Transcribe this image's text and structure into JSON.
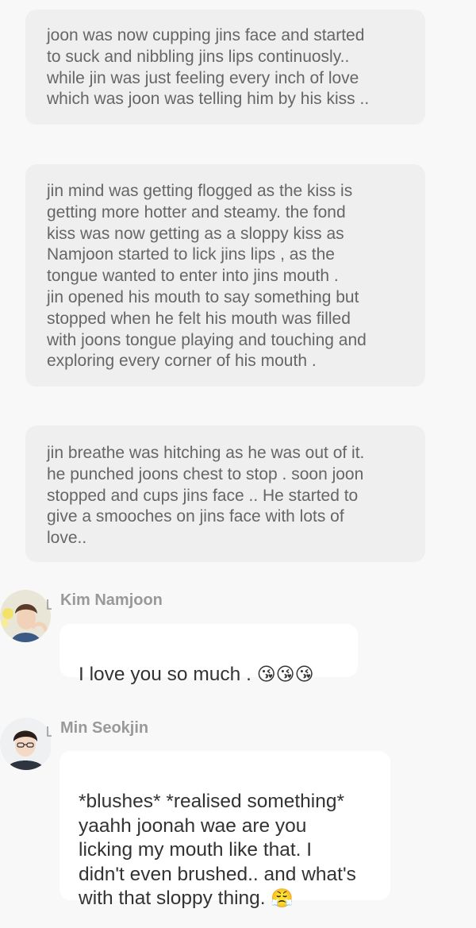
{
  "narrations": [
    {
      "text": "joon was now cupping jins face and started\nto suck and nibbling jins lips continuosly..\nwhile jin was just feeling every inch of love\nwhich was joon was telling him by his kiss .."
    },
    {
      "text": "jin mind was getting flogged as the kiss is\ngetting more hotter and steamy.  the fond\nkiss was now getting as a sloppy kiss as\nNamjoon started to lick jins lips , as the\ntongue wanted to enter into jins mouth .\njin opened his mouth to say something but\nstopped when he felt his mouth was filled\nwith joons tongue playing and touching and\nexploring every corner of his mouth ."
    },
    {
      "text": "jin breathe was hitching as he was out of it.\nhe punched joons chest to stop . soon joon\nstopped and cups jins face .. He started to\ngive a smooches on jins face with lots of\nlove.."
    }
  ],
  "messages": [
    {
      "sender": "Kim Namjoon",
      "text": "I love you so much . ",
      "emoji": "😘😘😘",
      "avatar": "namjoon-avatar"
    },
    {
      "sender": "Min Seokjin",
      "text": "*blushes* *realised something*\nyaahh joonah wae are you\nlicking my mouth like that.  I\ndidn't even brushed.. and what's\nwith that sloppy thing.  ",
      "emoji": "😤",
      "avatar": "seokjin-avatar"
    }
  ],
  "colors": {
    "background": "#f8f8f8",
    "narration_bg": "#efefef",
    "bubble_bg": "#ffffff",
    "narration_text": "#666666",
    "message_text": "#333333",
    "sender_text": "#999999"
  }
}
